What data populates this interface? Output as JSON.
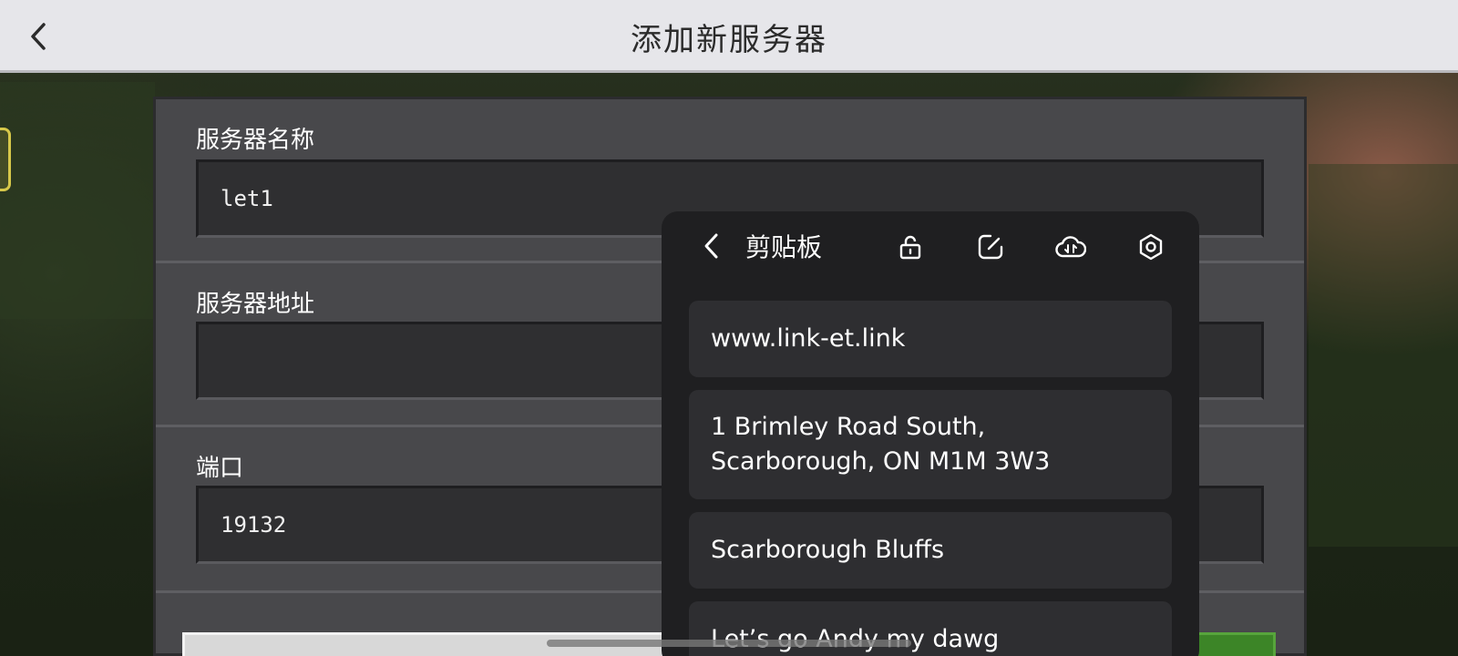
{
  "header": {
    "back_icon": "chevron-left-icon",
    "title": "添加新服务器"
  },
  "form": {
    "name_label": "服务器名称",
    "name_value": "let1",
    "address_label": "服务器地址",
    "address_value": "",
    "port_label": "端口",
    "port_value": "19132"
  },
  "clipboard": {
    "title": "剪贴板",
    "back_icon": "chevron-left-icon",
    "tools": [
      "unlock-icon",
      "edit-icon",
      "cloud-sync-icon",
      "settings-icon"
    ],
    "items": [
      "www.link-et.link",
      "1 Brimley Road South, Scarborough, ON M1M 3W3",
      "Scarborough Bluffs",
      "Let’s go Andy my dawg"
    ]
  },
  "colors": {
    "topbar": "#e6e6ea",
    "panel": "#48484b",
    "field": "#2f2f31",
    "clipboard_bg": "#1f1f21",
    "clipboard_item": "#2e2e31",
    "add_button_green": "#3c8527"
  }
}
